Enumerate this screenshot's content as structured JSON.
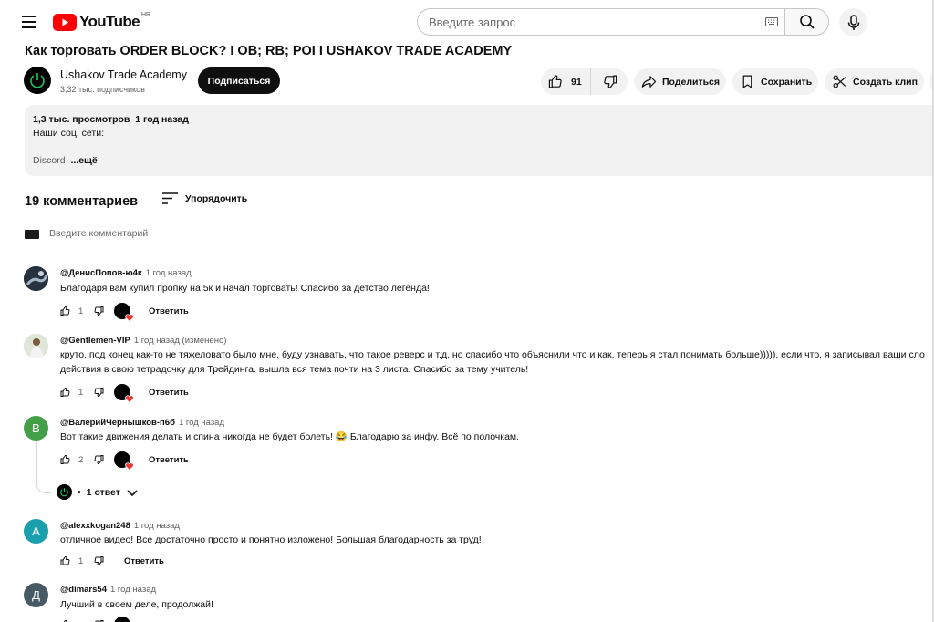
{
  "header": {
    "logo_text": "YouTube",
    "logo_region": "HR",
    "search_placeholder": "Введите запрос"
  },
  "video": {
    "title": "Как торговать ORDER BLOCK? I OB; RB; POI I USHAKOV TRADE ACADEMY",
    "channel_name": "Ushakov Trade Academy",
    "channel_subs": "3,32 тыс. подписчиков",
    "subscribe_label": "Подписаться",
    "likes": "91",
    "share_label": "Поделиться",
    "save_label": "Сохранить",
    "clip_label": "Создать клип"
  },
  "description": {
    "stats": "1,3 тыс. просмотров  1 год назад",
    "line1": "Наши соц. сети:",
    "line2": "Discord",
    "more": "...ещё"
  },
  "comments_section": {
    "count_label": "19 комментариев",
    "sort_label": "Упорядочить",
    "input_placeholder": "Введите комментарий",
    "reply_label": "Ответить",
    "replies_label": "1 ответ"
  },
  "comments": [
    {
      "author": "@ДенисПопов-ю4к",
      "time": "1 год назад",
      "lines": [
        "Благодаря вам купил пропку на 5к и начал торговать! Спасибо за детство легенда!"
      ],
      "likes": "1",
      "avatar_letter": "",
      "avatar_color": "#2b3a4a"
    },
    {
      "author": "@Gentlemen-VIP",
      "time": "1 год назад (изменено)",
      "lines": [
        "круто, под конец как-то не тяжеловато было мне, буду узнавать, что такое реверс и т.д, но спасибо что объяснили что и как, теперь я стал понимать больше))))), если что, я записывал ваши сло",
        "действия в свою тетрадочку для Трейдинга. вышла вся тема почти на  3 листа. Спасибо за тему учитель!"
      ],
      "likes": "1",
      "avatar_letter": "",
      "avatar_color": "#c9d6c4"
    },
    {
      "author": "@ВалерийЧернышков-п6б",
      "time": "1 год назад",
      "lines": [
        "Вот такие движения делать и спина никогда не будет болеть! 😂 Благодарю за инфу. Всё по полочкам."
      ],
      "likes": "2",
      "avatar_letter": "В",
      "avatar_color": "#43a047"
    },
    {
      "author": "@alexxkogan248",
      "time": "1 год назад",
      "lines": [
        "отличное видео! Все достаточно просто и понятно изложено! Большая благодарность за труд!"
      ],
      "likes": "1",
      "avatar_letter": "A",
      "avatar_color": "#1a9fad"
    },
    {
      "author": "@dimars54",
      "time": "1 год назад",
      "lines": [
        "Лучший в своем деле, продолжай!"
      ],
      "likes": "",
      "avatar_letter": "Д",
      "avatar_color": "#455a64"
    }
  ],
  "colors": {
    "brand_red": "#ff0000",
    "heart_red": "#e53935",
    "channel_green": "#22c55e"
  }
}
